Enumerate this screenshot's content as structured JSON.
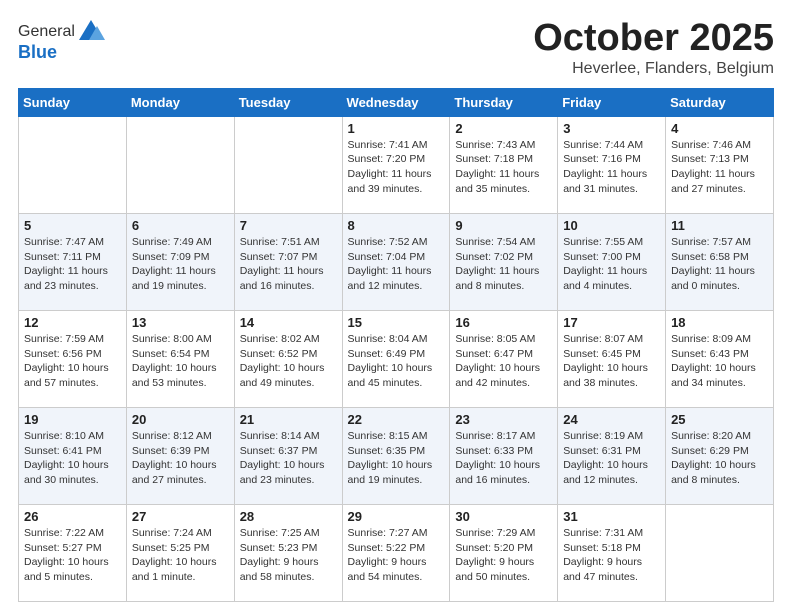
{
  "header": {
    "logo_line1": "General",
    "logo_line2": "Blue",
    "month": "October 2025",
    "location": "Heverlee, Flanders, Belgium"
  },
  "days_of_week": [
    "Sunday",
    "Monday",
    "Tuesday",
    "Wednesday",
    "Thursday",
    "Friday",
    "Saturday"
  ],
  "weeks": [
    [
      {
        "day": "",
        "info": ""
      },
      {
        "day": "",
        "info": ""
      },
      {
        "day": "",
        "info": ""
      },
      {
        "day": "1",
        "info": "Sunrise: 7:41 AM\nSunset: 7:20 PM\nDaylight: 11 hours\nand 39 minutes."
      },
      {
        "day": "2",
        "info": "Sunrise: 7:43 AM\nSunset: 7:18 PM\nDaylight: 11 hours\nand 35 minutes."
      },
      {
        "day": "3",
        "info": "Sunrise: 7:44 AM\nSunset: 7:16 PM\nDaylight: 11 hours\nand 31 minutes."
      },
      {
        "day": "4",
        "info": "Sunrise: 7:46 AM\nSunset: 7:13 PM\nDaylight: 11 hours\nand 27 minutes."
      }
    ],
    [
      {
        "day": "5",
        "info": "Sunrise: 7:47 AM\nSunset: 7:11 PM\nDaylight: 11 hours\nand 23 minutes."
      },
      {
        "day": "6",
        "info": "Sunrise: 7:49 AM\nSunset: 7:09 PM\nDaylight: 11 hours\nand 19 minutes."
      },
      {
        "day": "7",
        "info": "Sunrise: 7:51 AM\nSunset: 7:07 PM\nDaylight: 11 hours\nand 16 minutes."
      },
      {
        "day": "8",
        "info": "Sunrise: 7:52 AM\nSunset: 7:04 PM\nDaylight: 11 hours\nand 12 minutes."
      },
      {
        "day": "9",
        "info": "Sunrise: 7:54 AM\nSunset: 7:02 PM\nDaylight: 11 hours\nand 8 minutes."
      },
      {
        "day": "10",
        "info": "Sunrise: 7:55 AM\nSunset: 7:00 PM\nDaylight: 11 hours\nand 4 minutes."
      },
      {
        "day": "11",
        "info": "Sunrise: 7:57 AM\nSunset: 6:58 PM\nDaylight: 11 hours\nand 0 minutes."
      }
    ],
    [
      {
        "day": "12",
        "info": "Sunrise: 7:59 AM\nSunset: 6:56 PM\nDaylight: 10 hours\nand 57 minutes."
      },
      {
        "day": "13",
        "info": "Sunrise: 8:00 AM\nSunset: 6:54 PM\nDaylight: 10 hours\nand 53 minutes."
      },
      {
        "day": "14",
        "info": "Sunrise: 8:02 AM\nSunset: 6:52 PM\nDaylight: 10 hours\nand 49 minutes."
      },
      {
        "day": "15",
        "info": "Sunrise: 8:04 AM\nSunset: 6:49 PM\nDaylight: 10 hours\nand 45 minutes."
      },
      {
        "day": "16",
        "info": "Sunrise: 8:05 AM\nSunset: 6:47 PM\nDaylight: 10 hours\nand 42 minutes."
      },
      {
        "day": "17",
        "info": "Sunrise: 8:07 AM\nSunset: 6:45 PM\nDaylight: 10 hours\nand 38 minutes."
      },
      {
        "day": "18",
        "info": "Sunrise: 8:09 AM\nSunset: 6:43 PM\nDaylight: 10 hours\nand 34 minutes."
      }
    ],
    [
      {
        "day": "19",
        "info": "Sunrise: 8:10 AM\nSunset: 6:41 PM\nDaylight: 10 hours\nand 30 minutes."
      },
      {
        "day": "20",
        "info": "Sunrise: 8:12 AM\nSunset: 6:39 PM\nDaylight: 10 hours\nand 27 minutes."
      },
      {
        "day": "21",
        "info": "Sunrise: 8:14 AM\nSunset: 6:37 PM\nDaylight: 10 hours\nand 23 minutes."
      },
      {
        "day": "22",
        "info": "Sunrise: 8:15 AM\nSunset: 6:35 PM\nDaylight: 10 hours\nand 19 minutes."
      },
      {
        "day": "23",
        "info": "Sunrise: 8:17 AM\nSunset: 6:33 PM\nDaylight: 10 hours\nand 16 minutes."
      },
      {
        "day": "24",
        "info": "Sunrise: 8:19 AM\nSunset: 6:31 PM\nDaylight: 10 hours\nand 12 minutes."
      },
      {
        "day": "25",
        "info": "Sunrise: 8:20 AM\nSunset: 6:29 PM\nDaylight: 10 hours\nand 8 minutes."
      }
    ],
    [
      {
        "day": "26",
        "info": "Sunrise: 7:22 AM\nSunset: 5:27 PM\nDaylight: 10 hours\nand 5 minutes."
      },
      {
        "day": "27",
        "info": "Sunrise: 7:24 AM\nSunset: 5:25 PM\nDaylight: 10 hours\nand 1 minute."
      },
      {
        "day": "28",
        "info": "Sunrise: 7:25 AM\nSunset: 5:23 PM\nDaylight: 9 hours\nand 58 minutes."
      },
      {
        "day": "29",
        "info": "Sunrise: 7:27 AM\nSunset: 5:22 PM\nDaylight: 9 hours\nand 54 minutes."
      },
      {
        "day": "30",
        "info": "Sunrise: 7:29 AM\nSunset: 5:20 PM\nDaylight: 9 hours\nand 50 minutes."
      },
      {
        "day": "31",
        "info": "Sunrise: 7:31 AM\nSunset: 5:18 PM\nDaylight: 9 hours\nand 47 minutes."
      },
      {
        "day": "",
        "info": ""
      }
    ]
  ]
}
